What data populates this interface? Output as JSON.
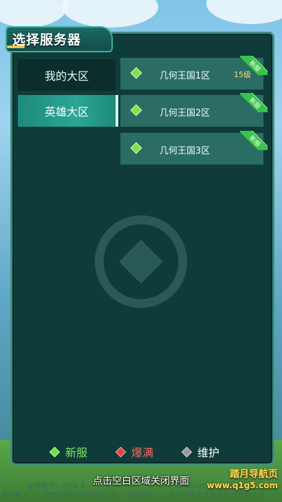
{
  "dialog": {
    "title": "选择服务器",
    "close_hint": "点击空白区域关闭界面"
  },
  "regions": [
    {
      "label": "我的大区",
      "active": false
    },
    {
      "label": "英雄大区",
      "active": true
    }
  ],
  "servers": [
    {
      "name": "几何王国1区",
      "level": "15级",
      "status": "new",
      "tag": "新服"
    },
    {
      "name": "几何王国2区",
      "level": "",
      "status": "new",
      "tag": "新服"
    },
    {
      "name": "几何王国3区",
      "level": "",
      "status": "new",
      "tag": "新服"
    }
  ],
  "legend": [
    {
      "label": "新服",
      "color": "#6fe04a",
      "text_color": "#7fe463"
    },
    {
      "label": "爆满",
      "color": "#e2463d",
      "text_color": "#f06a62"
    },
    {
      "label": "维护",
      "color": "#9a9a9a",
      "text_color": "#ffffff"
    }
  ],
  "footer": {
    "line1": "出版物号：ISBN 9",
    "line1b": "广出审[2016]841号",
    "line2": "著作权人：上海烛际网络科技有限公司",
    "line2b": "出版单位：上海科学技术文献出版社有限公司"
  },
  "brand": {
    "line1": "踏月导航页",
    "line2": "www.q1g5.com"
  }
}
